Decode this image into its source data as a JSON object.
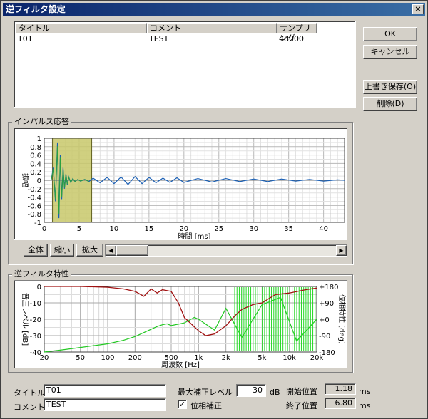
{
  "window": {
    "title": "逆フィルタ設定",
    "close": "×"
  },
  "buttons": {
    "ok": "OK",
    "cancel": "キャンセル",
    "overwrite_save": "上書き保存(O)",
    "delete": "削除(D)"
  },
  "list": {
    "columns": [
      "タイトル",
      "コメント",
      "サンプリング"
    ],
    "rows": [
      [
        "T01",
        "TEST",
        "48000"
      ]
    ]
  },
  "impulse": {
    "group_label": "インパルス応答",
    "ylabel": "振幅",
    "xlabel": "時間 [ms]",
    "yticks": [
      "1",
      "0.8",
      "0.6",
      "0.4",
      "0.2",
      "0",
      "-0.2",
      "-0.4",
      "-0.6",
      "-0.8",
      "-1"
    ],
    "xticks": [
      "0",
      "5",
      "10",
      "15",
      "20",
      "25",
      "30",
      "35",
      "40"
    ],
    "window_range_ms": [
      1.18,
      6.8
    ],
    "zoom_all": "全体",
    "zoom_out": "縮小",
    "zoom_in": "拡大",
    "scroll_left": "◀",
    "scroll_right": "▶"
  },
  "inverse": {
    "group_label": "逆フィルタ特性",
    "ylabel_left": "音圧レベル [dB]",
    "ylabel_right": "位相特性 [deg]",
    "xlabel": "周波数 [Hz]",
    "yticks_left": [
      "0",
      "-10",
      "-20",
      "-30",
      "-40"
    ],
    "yticks_right": [
      "+180",
      "+90",
      "+0",
      "-90",
      "-180"
    ],
    "xticks": [
      "20",
      "50",
      "100",
      "200",
      "500",
      "1k",
      "2k",
      "5k",
      "10k",
      "20k"
    ]
  },
  "chart_data": [
    {
      "type": "line",
      "title": "インパルス応答",
      "xlabel": "時間 [ms]",
      "ylabel": "振幅",
      "xlim": [
        0,
        43
      ],
      "ylim": [
        -1,
        1
      ],
      "grid": true,
      "series": [
        {
          "x": [
            1.0,
            1.3,
            1.6,
            1.9,
            2.1,
            2.3,
            2.5,
            2.7,
            2.9,
            3.1,
            3.3,
            3.5,
            3.8,
            4.1,
            4.4,
            4.8,
            5.2,
            5.8,
            6.4,
            7.0,
            8.0,
            9.0,
            10.0,
            11.0,
            12.0,
            13.0,
            14.0,
            15.0,
            16.0,
            17.0,
            18.0,
            19.0,
            20.0,
            22.0,
            24.0,
            26.0,
            28.0,
            30.0,
            32.0,
            34.0,
            36.0,
            38.0,
            40.0,
            42.0,
            43.0
          ],
          "y": [
            0,
            0.3,
            -0.5,
            0.9,
            -0.9,
            0.6,
            -0.45,
            0.3,
            -0.2,
            0.15,
            -0.1,
            0.08,
            -0.05,
            0.04,
            -0.03,
            0.02,
            -0.02,
            0.02,
            -0.03,
            0.05,
            -0.06,
            0.07,
            -0.08,
            0.08,
            -0.1,
            0.09,
            -0.08,
            0.07,
            -0.06,
            0.05,
            -0.05,
            0.06,
            -0.05,
            0.04,
            -0.04,
            0.04,
            -0.03,
            0.03,
            -0.03,
            0.03,
            -0.02,
            0.02,
            -0.02,
            0.01,
            0
          ]
        }
      ]
    },
    {
      "type": "line",
      "title": "逆フィルタ特性",
      "xlabel": "周波数 [Hz]",
      "ylabel": "音圧レベル [dB]",
      "ylabel_right": "位相特性 [deg]",
      "x_scale": "log",
      "xlim": [
        20,
        20000
      ],
      "ylim": [
        -40,
        0
      ],
      "y2lim": [
        -180,
        180
      ],
      "grid": true,
      "series": [
        {
          "axis": "left",
          "x": [
            20,
            50,
            100,
            150,
            200,
            250,
            300,
            350,
            400,
            500,
            600,
            700,
            800,
            1000,
            1200,
            1500,
            2000,
            2500,
            3000,
            4000,
            5000,
            7000,
            10000,
            15000,
            20000
          ],
          "y": [
            0,
            0,
            -0.5,
            -1.5,
            -3,
            -6,
            -1.5,
            -4,
            -2,
            -3,
            -10,
            -19,
            -22,
            -27,
            -30,
            -29,
            -24,
            -18,
            -14,
            -11,
            -10,
            -5,
            -4,
            -2,
            -1
          ]
        },
        {
          "axis": "right",
          "x": [
            20,
            30,
            50,
            70,
            100,
            150,
            200,
            300,
            350,
            400,
            450,
            500,
            700,
            900,
            1000,
            1500,
            2000,
            3000,
            5000,
            8000,
            12000,
            20000
          ],
          "y": [
            -180,
            -170,
            -155,
            -145,
            -135,
            -115,
            -95,
            -55,
            -40,
            -30,
            -25,
            -35,
            -20,
            10,
            0,
            -60,
            60,
            -100,
            80,
            120,
            -120,
            0
          ]
        }
      ]
    }
  ],
  "settings": {
    "title_label": "タイトル",
    "title_value": "T01",
    "comment_label": "コメント",
    "comment_value": "TEST",
    "max_correction_label": "最大補正レベル",
    "max_correction_value": "30",
    "max_correction_unit": "dB",
    "phase_correction_label": "位相補正",
    "phase_correction_checked": true,
    "check_mark": "✓",
    "start_label": "開始位置",
    "start_value": "1.18",
    "start_unit": "ms",
    "end_label": "終了位置",
    "end_value": "6.80",
    "end_unit": "ms"
  }
}
